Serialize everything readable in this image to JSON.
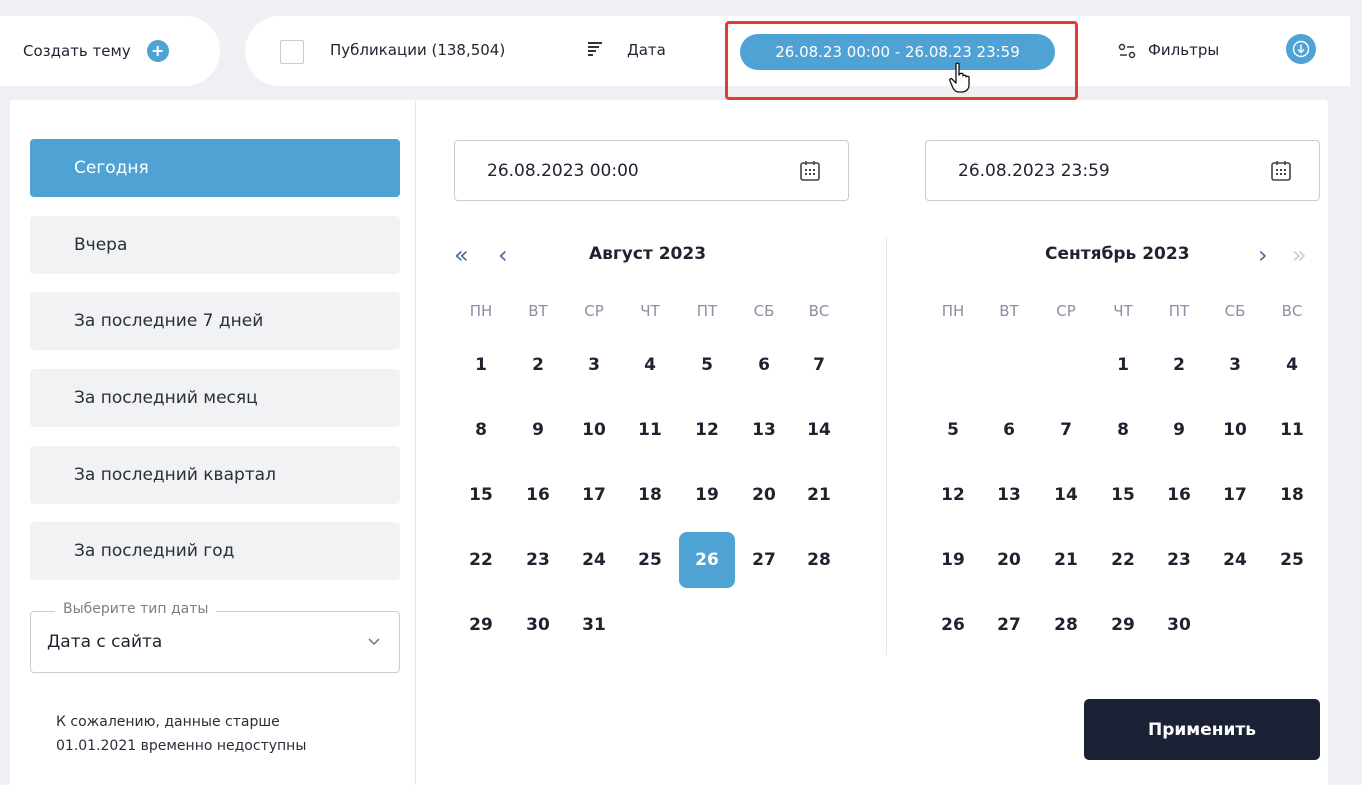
{
  "create_topic": {
    "label": "Создать тему"
  },
  "toolbar": {
    "publications_label": "Публикации (138,504)",
    "sort_label": "Дата",
    "date_range": "26.08.23 00:00 - 26.08.23 23:59",
    "filters_label": "Фильтры"
  },
  "presets": [
    {
      "label": "Сегодня",
      "active": true
    },
    {
      "label": "Вчера",
      "active": false
    },
    {
      "label": "За последние 7 дней",
      "active": false
    },
    {
      "label": "За последний месяц",
      "active": false
    },
    {
      "label": "За последний квартал",
      "active": false
    },
    {
      "label": "За последний год",
      "active": false
    }
  ],
  "date_type": {
    "legend": "Выберите тип даты",
    "value": "Дата с сайта"
  },
  "notice": {
    "line1": "К сожалению, данные старше",
    "line2": "01.01.2021 временно недоступны"
  },
  "start_input": {
    "value": "26.08.2023 00:00"
  },
  "end_input": {
    "value": "26.08.2023 23:59"
  },
  "weekdays": [
    "ПН",
    "ВТ",
    "СР",
    "ЧТ",
    "ПТ",
    "СБ",
    "ВС"
  ],
  "calendars": [
    {
      "title": "Август 2023",
      "first_weekday": 1,
      "days": 31,
      "selected": 26
    },
    {
      "title": "Сентябрь 2023",
      "first_weekday": 4,
      "days": 30,
      "selected": null
    }
  ],
  "apply_label": "Применить",
  "accent_color": "#4fa3d4",
  "dark_color": "#1b2236"
}
